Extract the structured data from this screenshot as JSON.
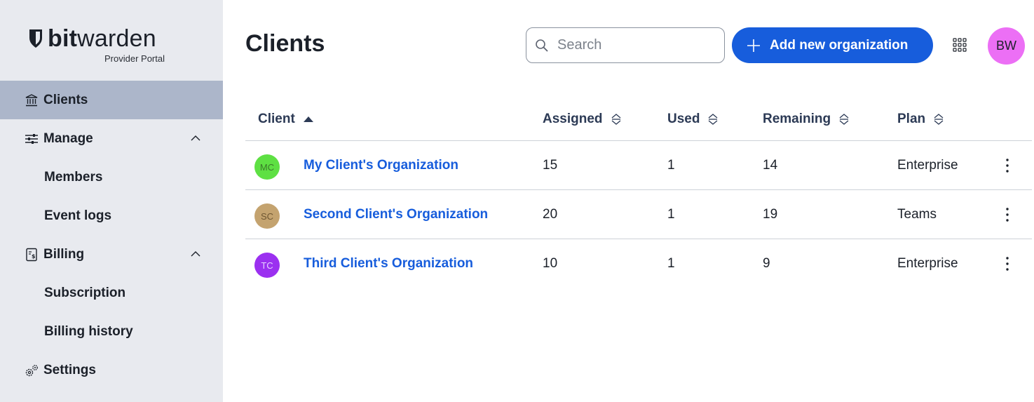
{
  "brand": {
    "name_bold": "bit",
    "name_light": "warden",
    "subtitle": "Provider Portal"
  },
  "sidebar": {
    "items": [
      {
        "label": "Clients",
        "icon": "bank-icon",
        "active": true
      },
      {
        "label": "Manage",
        "icon": "sliders-icon",
        "expandable": true
      },
      {
        "label": "Members"
      },
      {
        "label": "Event logs"
      },
      {
        "label": "Billing",
        "icon": "billing-icon",
        "expandable": true
      },
      {
        "label": "Subscription"
      },
      {
        "label": "Billing history"
      },
      {
        "label": "Settings",
        "icon": "gears-icon"
      }
    ]
  },
  "header": {
    "title": "Clients",
    "search_placeholder": "Search",
    "add_button_label": "Add new organization",
    "user_initials": "BW"
  },
  "table": {
    "columns": [
      "Client",
      "Assigned",
      "Used",
      "Remaining",
      "Plan"
    ],
    "rows": [
      {
        "initials": "MC",
        "avatar_color": "#5ee043",
        "name": "My Client's Organization",
        "assigned": "15",
        "used": "1",
        "remaining": "14",
        "plan": "Enterprise"
      },
      {
        "initials": "SC",
        "avatar_color": "#c4a36f",
        "name": "Second Client's Organization",
        "assigned": "20",
        "used": "1",
        "remaining": "19",
        "plan": "Teams"
      },
      {
        "initials": "TC",
        "avatar_color": "#9b30f0",
        "name": "Third Client's Organization",
        "assigned": "10",
        "used": "1",
        "remaining": "9",
        "plan": "Enterprise"
      }
    ]
  },
  "colors": {
    "accent": "#175ddc",
    "sidebar_bg": "#e8eaef",
    "active_nav": "#acb6ca",
    "user_avatar": "#ec6ff5"
  }
}
